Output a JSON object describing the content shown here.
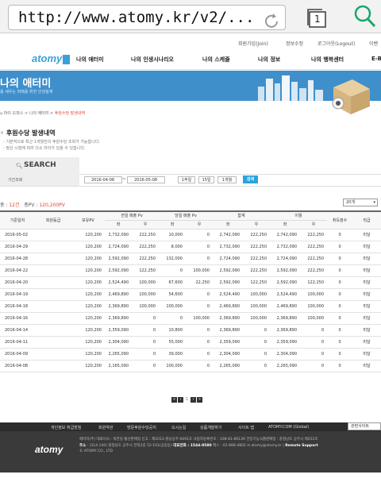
{
  "browser": {
    "url": "http://www.atomy.kr/v2/...",
    "tab_count": "1"
  },
  "top_links": [
    "회원가입(Join)",
    "정보수정",
    "로그아웃(Logout)",
    "이벤"
  ],
  "logo": "atomy",
  "nav": [
    "나의 애터미",
    "나의 인생시나리오",
    "나의 스케줄",
    "나의 정보",
    "나의 행복센터",
    "E-B"
  ],
  "banner": {
    "title": "나의 애터미",
    "subtitle": "를 세우는 미래를 위한 인생설계"
  },
  "breadcrumb": {
    "path": "마이 오피스 > 나의 애터미 > ",
    "current": "후원수당 발생내역"
  },
  "section_title": "후원수당 발생내역",
  "notes": [
    "- 기본적으로 최근 1개월전의 후원수당 조회가 가능합니다.",
    "- 정산 시점에 따라 다소 차이가 있을 수 있습니다."
  ],
  "search": {
    "label": "SEARCH",
    "period_label": "기간조회",
    "start_date": "2016-04-08",
    "end_date": "2016-05-08",
    "period_buttons": [
      "1주일",
      "15일",
      "1개월"
    ],
    "submit": "검색"
  },
  "summary": {
    "total_prefix": "총 : ",
    "total_count": "12건",
    "sum_prefix": "총PV : ",
    "sum_value": "120,200PV"
  },
  "page_size": "20개",
  "table": {
    "headers": {
      "date": "기준일자",
      "grade": "회원등급",
      "own_pv": "보유PV",
      "prev_sales": "전일 매출 Pv",
      "cur_sales": "당일 매출 Pv",
      "total": "합계",
      "carry": "이월",
      "achieved": "취득점수",
      "status": "직급",
      "left": "좌",
      "right": "우"
    },
    "rows": [
      [
        "2016-05-02",
        "",
        "120,200",
        "2,732,090",
        "222,250",
        "10,000",
        "0",
        "2,742,090",
        "222,250",
        "2,742,090",
        "222,250",
        "0",
        "미달"
      ],
      [
        "2016-04-29",
        "",
        "120,200",
        "2,724,090",
        "222,250",
        "8,000",
        "0",
        "2,732,090",
        "222,250",
        "2,732,090",
        "222,250",
        "0",
        "미달"
      ],
      [
        "2016-04-28",
        "",
        "120,200",
        "2,592,090",
        "222,250",
        "132,000",
        "0",
        "2,724,090",
        "222,250",
        "2,724,090",
        "222,250",
        "0",
        "미달"
      ],
      [
        "2016-04-22",
        "",
        "120,200",
        "2,592,090",
        "122,250",
        "0",
        "100,000",
        "2,592,090",
        "222,250",
        "2,592,090",
        "222,250",
        "0",
        "미달"
      ],
      [
        "2016-04-20",
        "",
        "120,200",
        "2,524,490",
        "100,000",
        "67,600",
        "22,250",
        "2,592,090",
        "122,250",
        "2,592,090",
        "122,250",
        "0",
        "미달"
      ],
      [
        "2016-04-19",
        "",
        "120,200",
        "2,469,890",
        "100,000",
        "54,600",
        "0",
        "2,524,490",
        "100,000",
        "2,524,490",
        "100,000",
        "0",
        "미달"
      ],
      [
        "2016-04-18",
        "",
        "120,200",
        "2,369,890",
        "100,000",
        "100,000",
        "0",
        "2,469,890",
        "100,000",
        "2,469,890",
        "100,000",
        "0",
        "미달"
      ],
      [
        "2016-04-16",
        "",
        "120,200",
        "2,369,890",
        "0",
        "0",
        "100,000",
        "2,369,890",
        "100,000",
        "2,369,890",
        "100,000",
        "0",
        "미달"
      ],
      [
        "2016-04-14",
        "",
        "120,200",
        "2,359,090",
        "0",
        "10,800",
        "0",
        "2,369,890",
        "0",
        "2,369,890",
        "0",
        "0",
        "미달"
      ],
      [
        "2016-04-11",
        "",
        "120,200",
        "2,304,090",
        "0",
        "55,000",
        "0",
        "2,359,090",
        "0",
        "2,359,090",
        "0",
        "0",
        "미달"
      ],
      [
        "2016-04-09",
        "",
        "120,200",
        "2,265,090",
        "0",
        "39,000",
        "0",
        "2,304,090",
        "0",
        "2,304,090",
        "0",
        "0",
        "미달"
      ],
      [
        "2016-04-08",
        "",
        "120,200",
        "2,165,090",
        "0",
        "100,000",
        "0",
        "2,265,090",
        "0",
        "2,265,090",
        "0",
        "0",
        "미달"
      ]
    ]
  },
  "pager": {
    "current": "1"
  },
  "footer": {
    "links": [
      "개인정보 취급방침",
      "회원약관",
      "방문후원수당공지",
      "오시는길",
      "상품개발하기",
      "사이트 맵",
      "ATOMY.COM (Global)"
    ],
    "family_site": "관련사이트",
    "logo": "atomy",
    "line1": "애터미(주)  대표이사 : 박한길   통신판매업 신고 : 제2013-충남공주-0091호   사업자등록번호 : 108-81-86139   건강기능식품판매업 : 충청남도 공주시 제252호",
    "line2_label": "주소",
    "line2": " : (314-140) 충청남도 공주시 한적2길 52-101(공동동)  ",
    "line2_tel_label": "대표전화 : 1544-8580",
    "line2_rest": "  팩스 : 02-888-4802  ✉ atomy@atomy.kr | ",
    "line2_remote": "Remote Support",
    "copyright": "© ATOMY CO., LTD"
  }
}
